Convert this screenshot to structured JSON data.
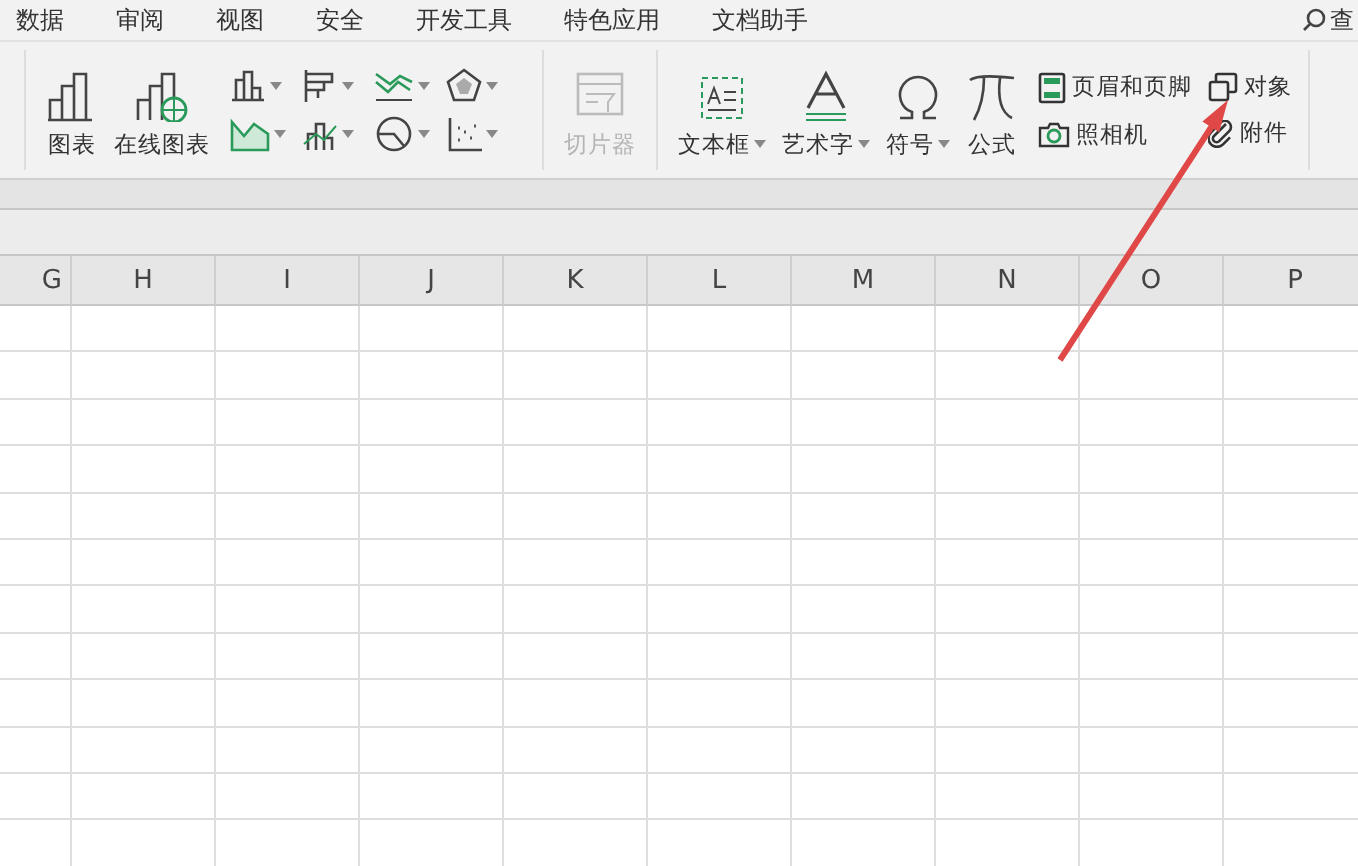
{
  "menu": [
    {
      "label": "数据"
    },
    {
      "label": "审阅"
    },
    {
      "label": "视图"
    },
    {
      "label": "安全"
    },
    {
      "label": "开发工具"
    },
    {
      "label": "特色应用"
    },
    {
      "label": "文档助手"
    }
  ],
  "search": {
    "label": "查"
  },
  "toolbar": {
    "big_buttons": [
      {
        "label": "图表",
        "kind": "chart",
        "has_caret": false,
        "disabled": false
      },
      {
        "label": "在线图表",
        "kind": "online-chart",
        "has_caret": false,
        "disabled": false
      }
    ],
    "chart_types": [
      {
        "kind": "column"
      },
      {
        "kind": "bar"
      },
      {
        "kind": "line"
      },
      {
        "kind": "radar"
      },
      {
        "kind": "area"
      },
      {
        "kind": "combo"
      },
      {
        "kind": "pie"
      },
      {
        "kind": "scatter"
      }
    ],
    "slicer": {
      "label": "切片器",
      "disabled": true
    },
    "insert_buttons": [
      {
        "label": "文本框",
        "kind": "textbox",
        "has_caret": true
      },
      {
        "label": "艺术字",
        "kind": "wordart",
        "has_caret": true
      },
      {
        "label": "符号",
        "kind": "symbol",
        "has_caret": true
      },
      {
        "label": "公式",
        "kind": "formula",
        "has_caret": false
      }
    ],
    "small_buttons": [
      {
        "label": "页眉和页脚",
        "kind": "header-footer"
      },
      {
        "label": "照相机",
        "kind": "camera"
      },
      {
        "label": "对象",
        "kind": "object"
      },
      {
        "label": "附件",
        "kind": "attachment"
      }
    ]
  },
  "columns": [
    "G",
    "H",
    "I",
    "J",
    "K",
    "L",
    "M",
    "N",
    "O",
    "P"
  ]
}
